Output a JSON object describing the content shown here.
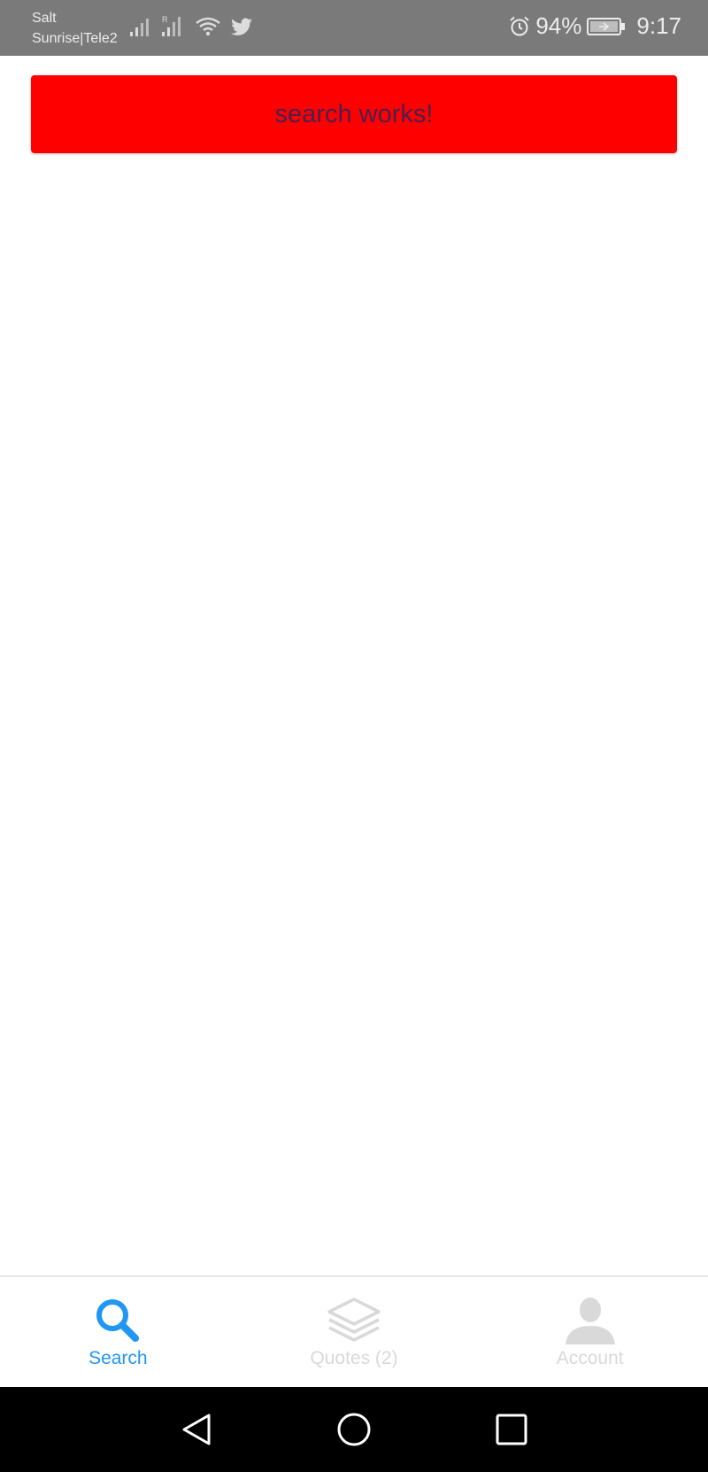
{
  "status_bar": {
    "carrier_1": "Salt",
    "carrier_2": "Sunrise|Tele2",
    "battery_percent": "94%",
    "time": "9:17"
  },
  "banner": {
    "text": "search works!",
    "background_color": "#ff0000"
  },
  "tabs": [
    {
      "label": "Search",
      "icon": "search-icon",
      "active": true,
      "color": "#2196f3"
    },
    {
      "label": "Quotes (2)",
      "icon": "layers-icon",
      "active": false,
      "color": "#d9d9d9"
    },
    {
      "label": "Account",
      "icon": "person-icon",
      "active": false,
      "color": "#d9d9d9"
    }
  ],
  "nav": {
    "buttons": [
      "back-icon",
      "home-icon",
      "recent-apps-icon"
    ]
  }
}
